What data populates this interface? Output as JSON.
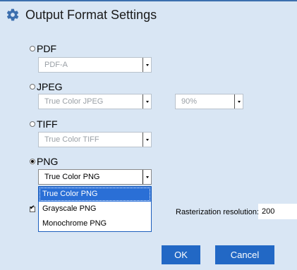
{
  "dialog": {
    "title": "Output Format Settings",
    "title_icon": "gear-icon"
  },
  "formats": {
    "pdf": {
      "label": "PDF",
      "selected": false,
      "type_select": "PDF-A"
    },
    "jpeg": {
      "label": "JPEG",
      "selected": false,
      "type_select": "True Color JPEG",
      "quality_select": "90%"
    },
    "tiff": {
      "label": "TIFF",
      "selected": false,
      "type_select": "True Color TIFF"
    },
    "png": {
      "label": "PNG",
      "selected": true,
      "type_select": "True Color PNG",
      "dropdown_options": [
        "True Color PNG",
        "Grayscale PNG",
        "Monochrome PNG"
      ],
      "highlighted_option": "True Color PNG"
    }
  },
  "rasterization": {
    "checkbox_checked": true,
    "label": "Rasterization resolution:",
    "value": "200"
  },
  "buttons": {
    "ok": "OK",
    "cancel": "Cancel"
  },
  "colors": {
    "background": "#d9e6f4",
    "accent": "#2268c5",
    "highlight": "#2a6fd6"
  }
}
